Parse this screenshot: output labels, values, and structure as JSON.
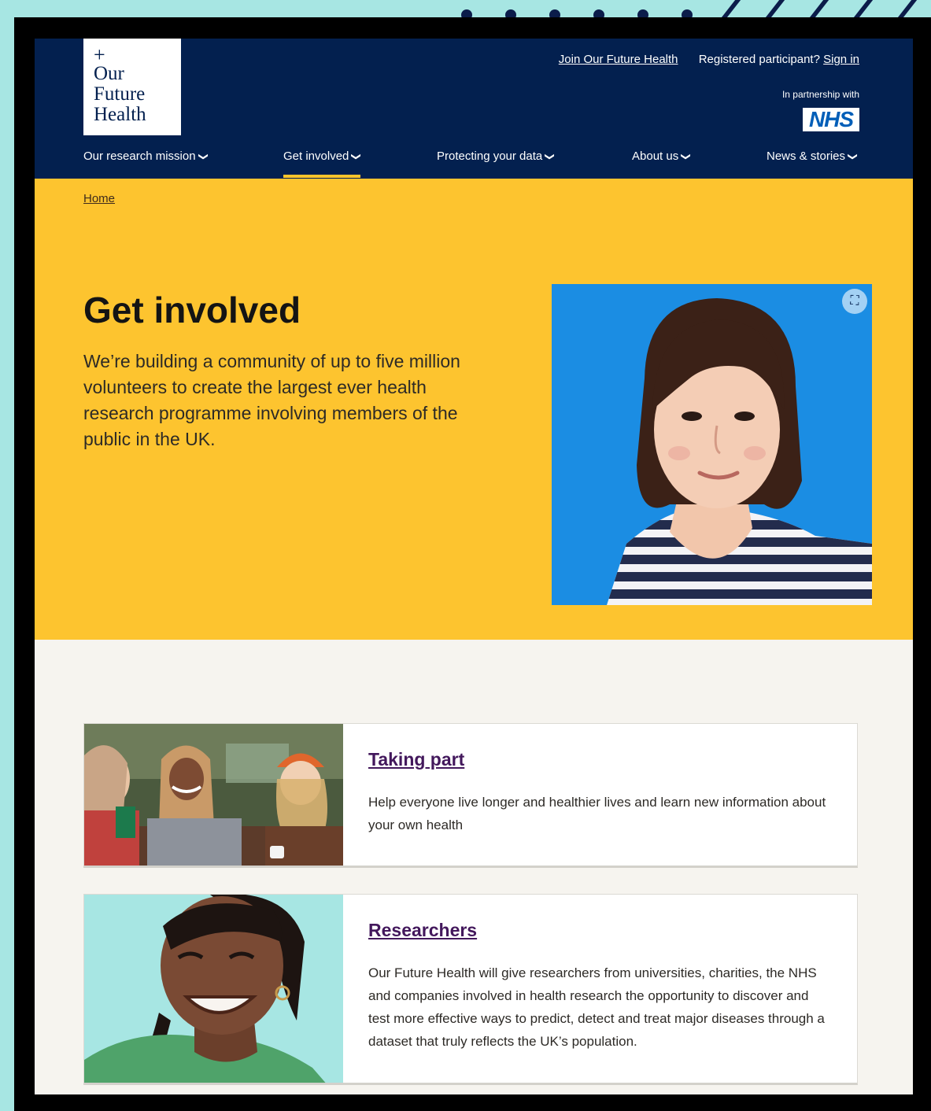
{
  "header": {
    "logo": {
      "symbol": "+",
      "lines": [
        "Our",
        "Future",
        "Health"
      ]
    },
    "join_link": "Join Our Future Health",
    "registered_text": "Registered participant?",
    "sign_in_link": "Sign in",
    "partnership_text": "In partnership with",
    "nhs_logo": "NHS"
  },
  "nav": {
    "items": [
      {
        "label": "Our research mission",
        "active": false
      },
      {
        "label": "Get involved",
        "active": true
      },
      {
        "label": "Protecting your data",
        "active": false
      },
      {
        "label": "About us",
        "active": false
      },
      {
        "label": "News & stories",
        "active": false
      }
    ]
  },
  "breadcrumb": {
    "home": "Home"
  },
  "hero": {
    "title": "Get involved",
    "text": "We’re building a community of up to five million volunteers to create the largest ever health research programme involving members of the public in the UK."
  },
  "cards": [
    {
      "title": "Taking part",
      "description": "Help everyone live longer and healthier lives and learn new information about your own health"
    },
    {
      "title": "Researchers",
      "description": "Our Future Health will give researchers from universities, charities, the NHS and companies involved in health research the opportunity to discover and test more effective ways to predict, detect and treat major diseases through a dataset that truly reflects the UK’s population."
    }
  ],
  "colors": {
    "header_bg": "#03204f",
    "hero_bg": "#fdc42f",
    "page_bg": "#f6f4ef",
    "link_purple": "#43185c",
    "nav_active_underline": "#ffc52c",
    "border_teal": "#a7e6e3"
  },
  "icons": {
    "nav_chevron": "chevron-down-icon",
    "image_expand": "expand-image-icon",
    "logo_plus": "plus-icon"
  }
}
